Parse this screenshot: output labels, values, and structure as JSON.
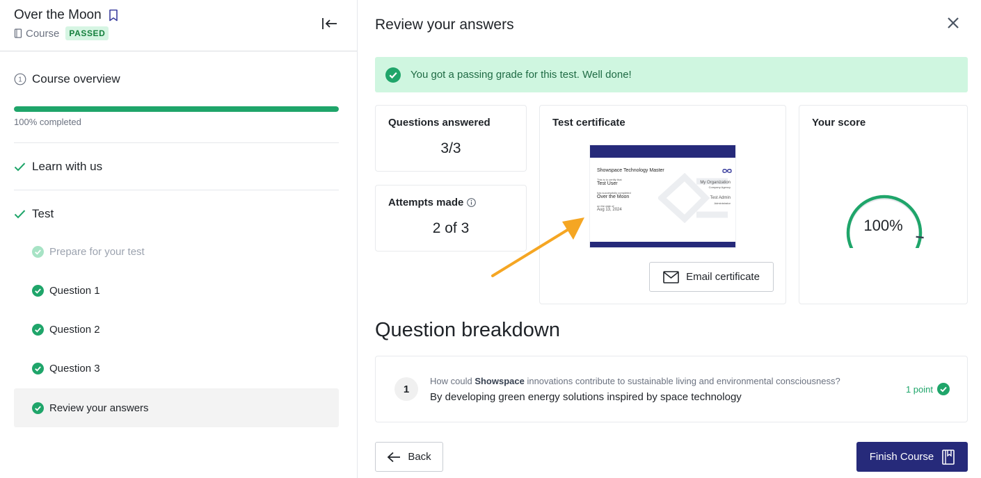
{
  "sidebar": {
    "course_title": "Over the Moon",
    "course_type": "Course",
    "status_badge": "PASSED",
    "overview_label": "Course overview",
    "progress_fraction": 1.0,
    "progress_label": "100% completed",
    "sections": [
      {
        "label": "Learn with us",
        "completed": true
      },
      {
        "label": "Test",
        "completed": true
      }
    ],
    "lessons": [
      {
        "label": "Prepare for your test",
        "state": "muted"
      },
      {
        "label": "Question 1",
        "state": "done"
      },
      {
        "label": "Question 2",
        "state": "done"
      },
      {
        "label": "Question 3",
        "state": "done"
      },
      {
        "label": "Review your answers",
        "state": "active"
      }
    ]
  },
  "main": {
    "title": "Review your answers",
    "alert_text": "You got a passing grade for this test. Well done!",
    "questions_card": {
      "title": "Questions answered",
      "value": "3/3"
    },
    "attempts_card": {
      "title": "Attempts made",
      "value": "2 of 3"
    },
    "certificate_card": {
      "title": "Test certificate",
      "email_button": "Email certificate",
      "preview": {
        "heading": "Showspace Technology Master",
        "certify_line": "This is to certify that",
        "recipient": "Test User",
        "completed_line": "has successfully completed",
        "course": "Over the Moon",
        "date_line": "on the date of",
        "date": "Aug 13, 2024",
        "org": "My Organization",
        "org_sub": "Company Agency",
        "admin": "Test Admin",
        "admin_sub": "Administrator"
      }
    },
    "score_card": {
      "title": "Your score",
      "value": "100%",
      "score_fraction": 1.0
    },
    "breakdown_title": "Question breakdown",
    "question": {
      "number": "1",
      "text_before": "How could ",
      "text_bold": "Showspace",
      "text_after": " innovations contribute to sustainable living and environmental consciousness?",
      "answer": "By developing green energy solutions inspired by space technology",
      "points": "1 point"
    },
    "back_button": "Back",
    "finish_button": "Finish Course"
  },
  "colors": {
    "success": "#1fa56a",
    "brand": "#262a7a",
    "alert_bg": "#cff6e0",
    "annotation": "#f5a623"
  }
}
